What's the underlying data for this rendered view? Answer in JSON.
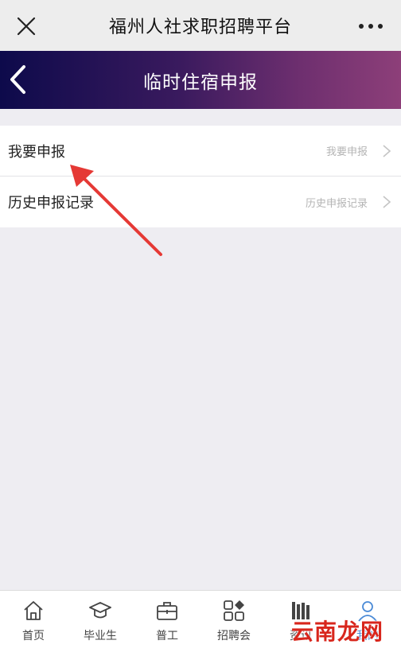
{
  "topbar": {
    "title": "福州人社求职招聘平台"
  },
  "header": {
    "title": "临时住宿申报"
  },
  "list": {
    "items": [
      {
        "label": "我要申报",
        "hint": "我要申报"
      },
      {
        "label": "历史申报记录",
        "hint": "历史申报记录"
      }
    ]
  },
  "tabbar": {
    "tabs": [
      {
        "label": "首页",
        "icon": "home-icon"
      },
      {
        "label": "毕业生",
        "icon": "graduation-cap-icon"
      },
      {
        "label": "普工",
        "icon": "briefcase-icon"
      },
      {
        "label": "招聘会",
        "icon": "apps-grid-icon"
      },
      {
        "label": "资讯",
        "icon": "books-icon"
      },
      {
        "label": "我的",
        "icon": "user-icon"
      }
    ],
    "active_index": 5
  },
  "watermark": {
    "text": "云南龙网"
  },
  "colors": {
    "accent_red": "#e53935",
    "tab_active": "#4a8ad6"
  }
}
